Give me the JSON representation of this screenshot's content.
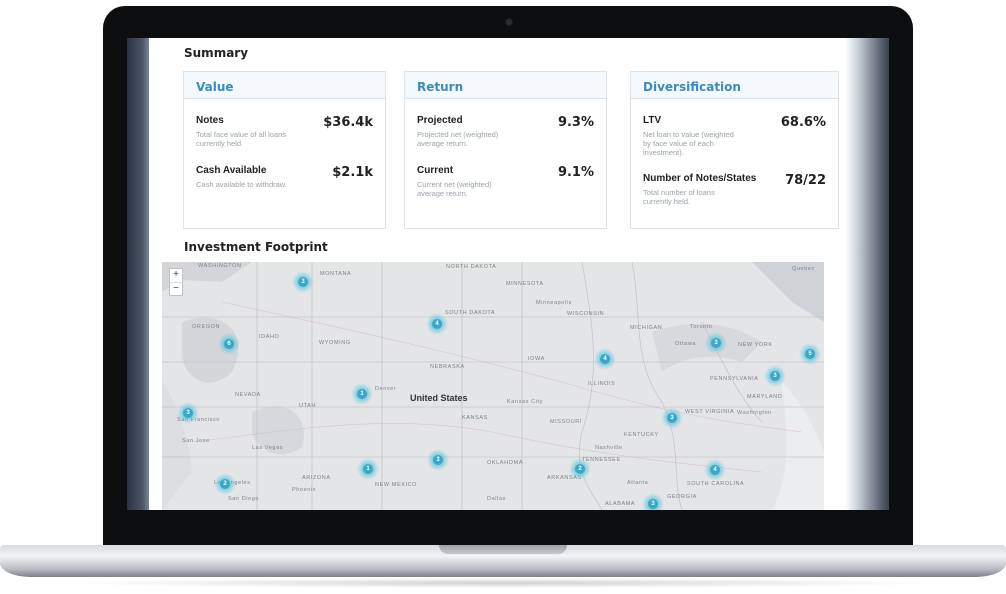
{
  "summary": {
    "title": "Summary",
    "cards": [
      {
        "title": "Value",
        "metrics": [
          {
            "label": "Notes",
            "value": "$36.4k",
            "desc": "Total face value of all loans currently held."
          },
          {
            "label": "Cash Available",
            "value": "$2.1k",
            "desc": "Cash available to withdraw."
          }
        ]
      },
      {
        "title": "Return",
        "metrics": [
          {
            "label": "Projected",
            "value": "9.3%",
            "desc": "Projected net (weighted) average return."
          },
          {
            "label": "Current",
            "value": "9.1%",
            "desc": "Current net (weighted) average return."
          }
        ]
      },
      {
        "title": "Diversification",
        "metrics": [
          {
            "label": "LTV",
            "value": "68.6%",
            "desc": "Net loan to value (weighted by face value of each investment)."
          },
          {
            "label": "Number of Notes/States",
            "value": "78/22",
            "desc": "Total number of loans currently held."
          }
        ]
      }
    ]
  },
  "footprint": {
    "title": "Investment Footprint",
    "zoom_in": "+",
    "zoom_out": "−",
    "country_label": "United States",
    "place_labels": [
      "WASHINGTON",
      "MONTANA",
      "NORTH DAKOTA",
      "MINNESOTA",
      "Minneapolis",
      "WISCONSIN",
      "SOUTH DAKOTA",
      "OREGON",
      "IDAHO",
      "WYOMING",
      "MICHIGAN",
      "Toronto",
      "Ottawa",
      "NEW YORK",
      "IOWA",
      "NEBRASKA",
      "ILLINOIS",
      "PENNSYLVANIA",
      "Denver",
      "Kansas City",
      "NEVADA",
      "UTAH",
      "KANSAS",
      "MISSOURI",
      "WEST VIRGINIA",
      "San Francisco",
      "San Jose",
      "Las Vegas",
      "KENTUCKY",
      "OKLAHOMA",
      "TENNESSEE",
      "Nashville",
      "NEW MEXICO",
      "ARIZONA",
      "ARKANSAS",
      "Los Angeles",
      "San Diego",
      "Atlanta",
      "SOUTH CAROLINA",
      "Phoenix",
      "Dallas",
      "ALABAMA",
      "GEORGIA",
      "MARYLAND",
      "Washington",
      "Quebec"
    ],
    "cluster_counts": [
      "3",
      "6",
      "4",
      "4",
      "3",
      "5",
      "3",
      "1",
      "3",
      "3",
      "3",
      "1",
      "4",
      "2",
      "2",
      "3"
    ]
  }
}
